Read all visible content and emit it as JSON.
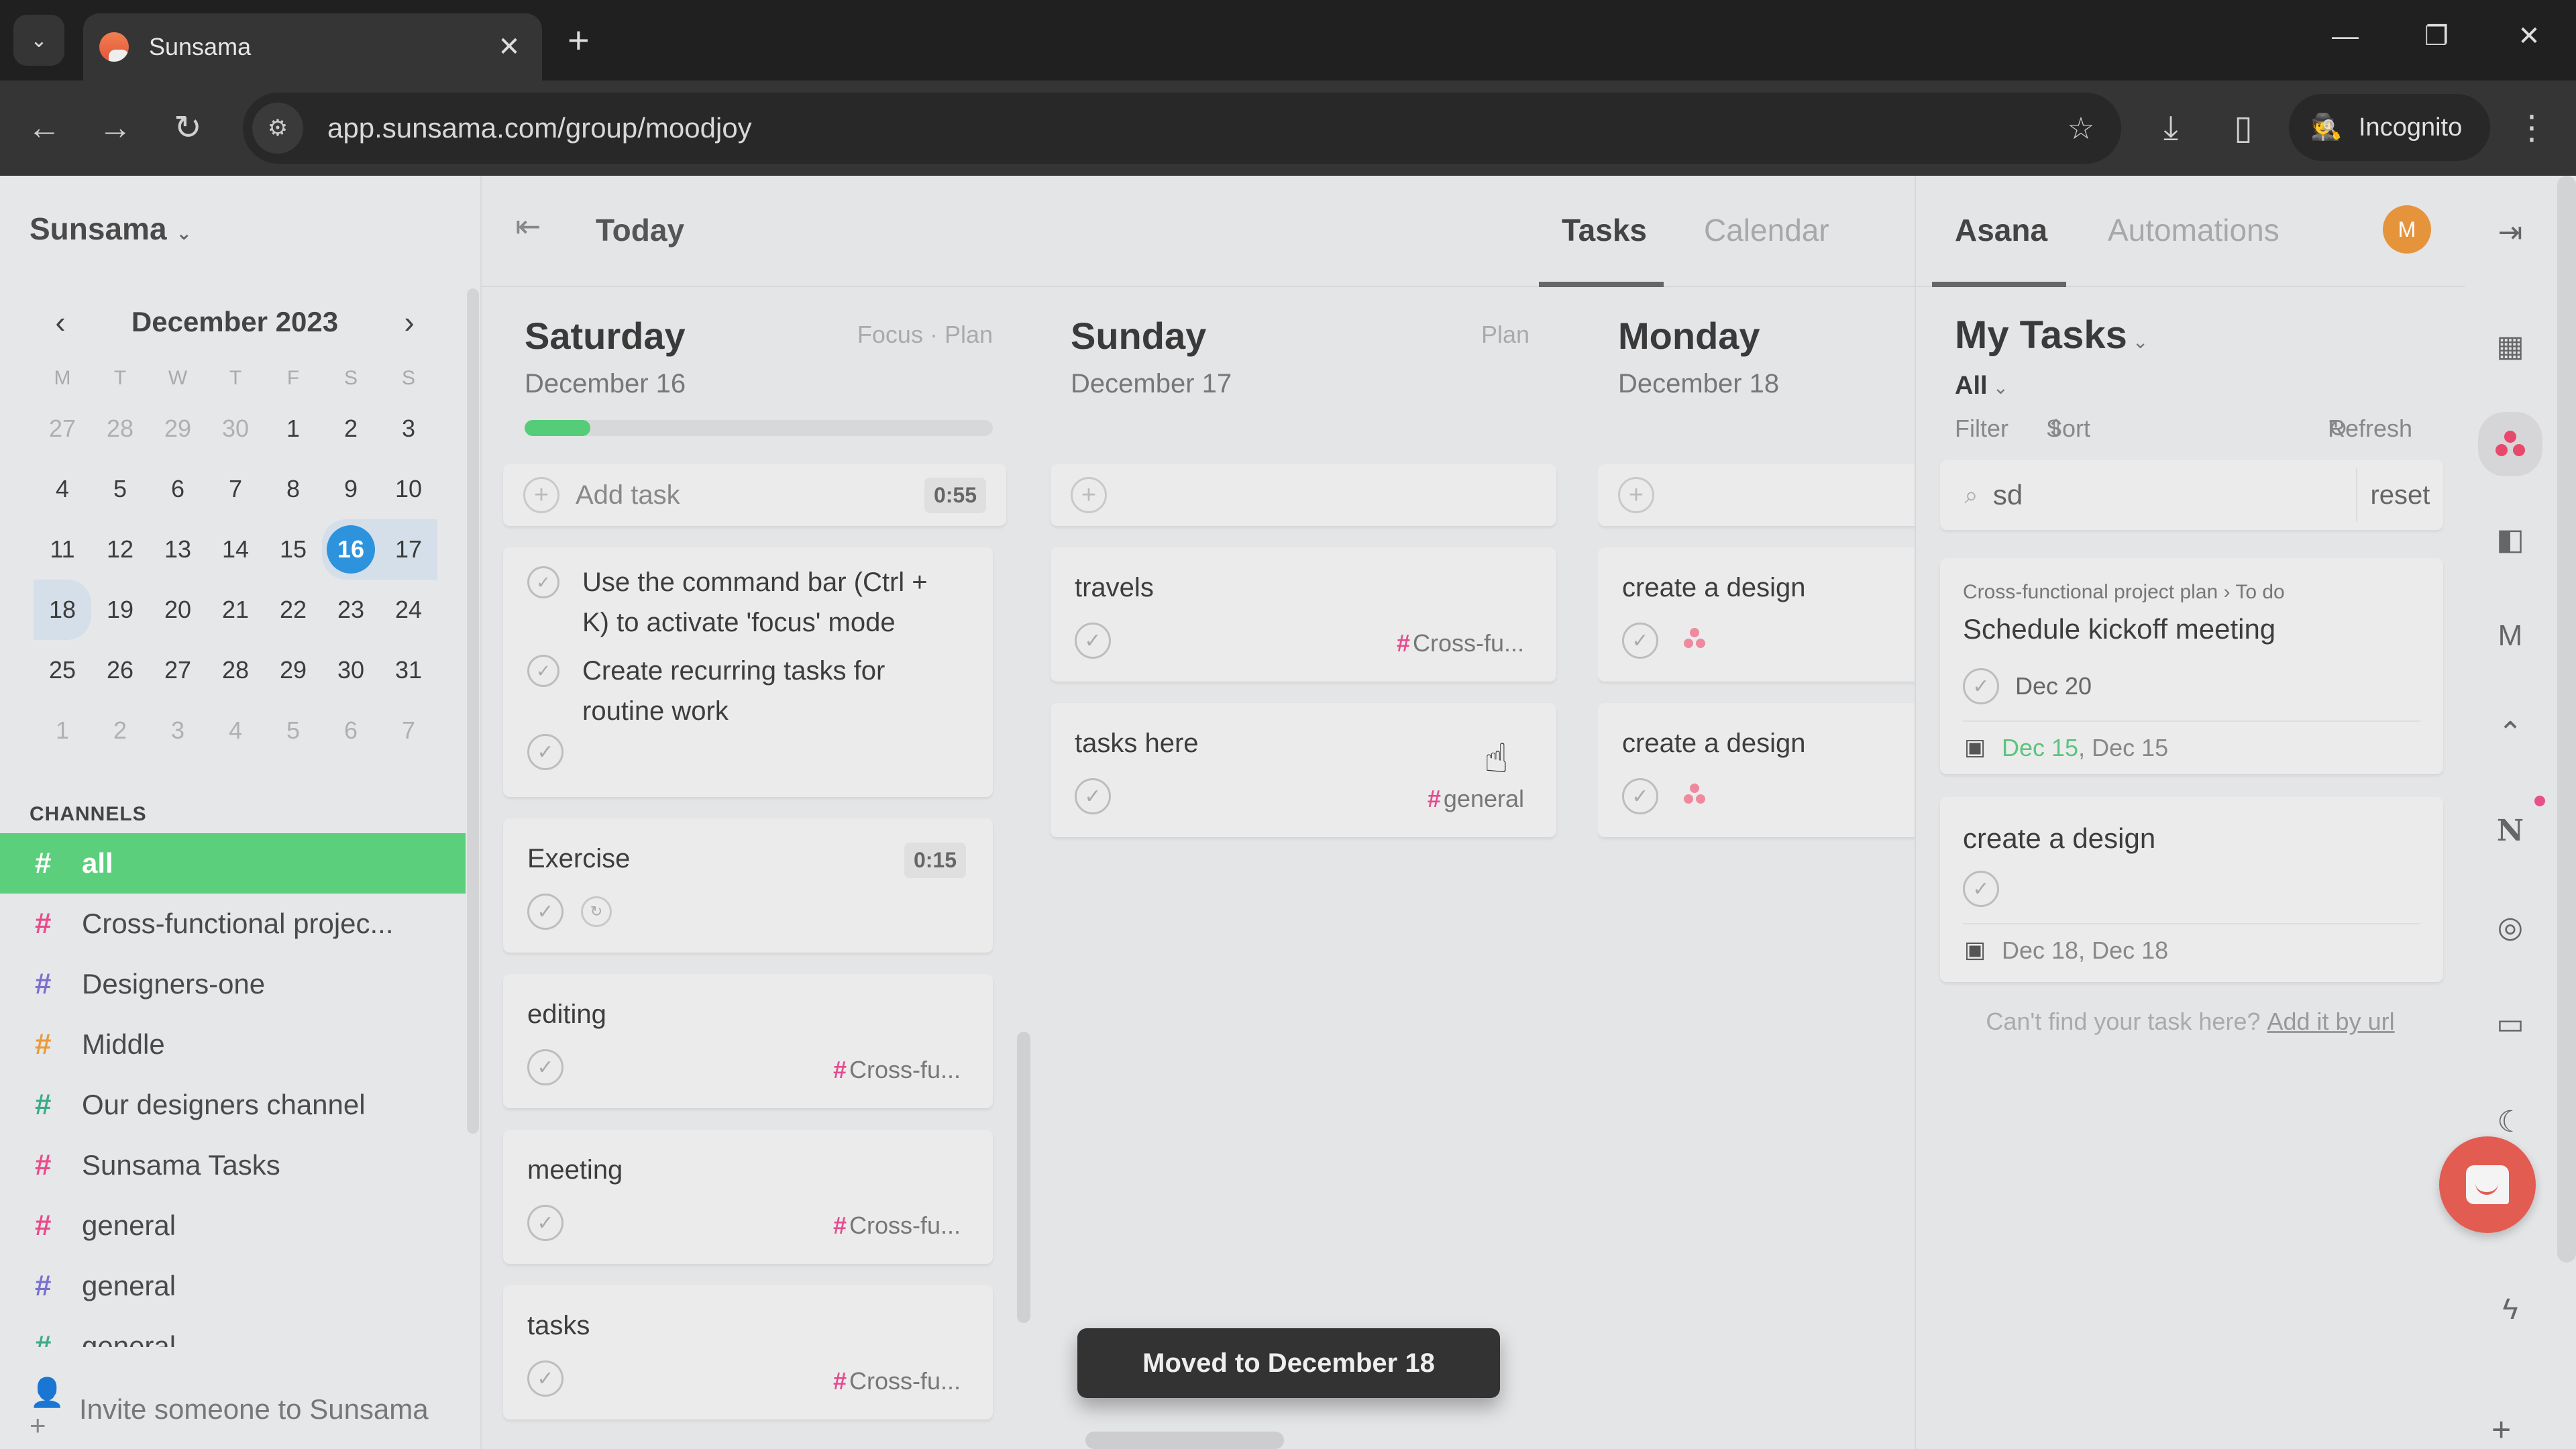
{
  "browser": {
    "tab_title": "Sunsama",
    "url": "app.sunsama.com/group/moodjoy",
    "profile_label": "Incognito",
    "icons": {
      "tab_list": "chevron-down-icon",
      "close_tab": "close-icon",
      "new_tab": "plus-icon",
      "back": "arrow-left-icon",
      "forward": "arrow-right-icon",
      "reload": "reload-icon",
      "site_info": "tune-icon",
      "bookmark": "star-icon",
      "download": "download-icon",
      "side_panel": "side-panel-icon",
      "incognito": "incognito-icon",
      "menu": "kebab-menu-icon",
      "minimize": "minimize-icon",
      "restore": "restore-icon",
      "close_window": "close-icon"
    },
    "glyphs": {
      "tab_list": "⌄",
      "close_tab": "✕",
      "new_tab": "+",
      "back": "←",
      "forward": "→",
      "reload": "↻",
      "site_info": "⚙",
      "bookmark": "☆",
      "download": "⤓",
      "side_panel": "▯",
      "incognito": "🕵",
      "menu": "⋮",
      "minimize": "—",
      "restore": "❐",
      "close_window": "✕"
    }
  },
  "sidebar": {
    "workspace": "Sunsama",
    "workspace_chevron": "⌄",
    "calendar": {
      "title": "December 2023",
      "prev": "‹",
      "next": "›",
      "weekdays": [
        "M",
        "T",
        "W",
        "T",
        "F",
        "S",
        "S"
      ],
      "weeks": [
        [
          "27",
          "28",
          "29",
          "30",
          "1",
          "2",
          "3"
        ],
        [
          "4",
          "5",
          "6",
          "7",
          "8",
          "9",
          "10"
        ],
        [
          "11",
          "12",
          "13",
          "14",
          "15",
          "16",
          "17"
        ],
        [
          "18",
          "19",
          "20",
          "21",
          "22",
          "23",
          "24"
        ],
        [
          "25",
          "26",
          "27",
          "28",
          "29",
          "30",
          "31"
        ],
        [
          "1",
          "2",
          "3",
          "4",
          "5",
          "6",
          "7"
        ]
      ],
      "today": "16",
      "visible_range": [
        "16",
        "17",
        "18"
      ]
    },
    "channels_label": "CHANNELS",
    "channels": [
      {
        "name": "all",
        "color": "#ffffff",
        "active": true
      },
      {
        "name": "Cross-functional projec...",
        "color": "#e84c8c"
      },
      {
        "name": "Designers-one",
        "color": "#7b6fd0"
      },
      {
        "name": "Middle",
        "color": "#eb9a3a"
      },
      {
        "name": "Our designers channel",
        "color": "#3daa88"
      },
      {
        "name": "Sunsama Tasks",
        "color": "#e84c8c"
      },
      {
        "name": "general",
        "color": "#e84c8c"
      },
      {
        "name": "general",
        "color": "#7b6fd0"
      },
      {
        "name": "general",
        "color": "#3daa88"
      }
    ],
    "invite_label": "Invite someone to Sunsama",
    "invite_icon": "👤+"
  },
  "header": {
    "collapse_icon": "⇤",
    "today_label": "Today",
    "tabs": [
      {
        "label": "Tasks",
        "active": true
      },
      {
        "label": "Calendar",
        "active": false
      }
    ]
  },
  "columns": [
    {
      "day": "Saturday",
      "date": "December 16",
      "actions": "Focus · Plan",
      "progress_percent": 14,
      "add_task_label": "Add task",
      "add_task_duration": "0:55",
      "checklist": [
        "Use the command bar (Ctrl + K) to activate 'focus' mode",
        "Create recurring tasks for routine work"
      ],
      "tasks": [
        {
          "title": "Exercise",
          "duration": "0:15",
          "recurring": true
        },
        {
          "title": "editing",
          "channel": "Cross-fu..."
        },
        {
          "title": "meeting",
          "channel": "Cross-fu..."
        },
        {
          "title": "tasks",
          "channel": "Cross-fu..."
        }
      ]
    },
    {
      "day": "Sunday",
      "date": "December 17",
      "actions": "Plan",
      "tasks": [
        {
          "title": "travels",
          "channel": "Cross-fu..."
        },
        {
          "title": "tasks here",
          "channel": "general"
        }
      ]
    },
    {
      "day": "Monday",
      "date": "December 18",
      "tasks": [
        {
          "title": "create a design",
          "source": "asana"
        },
        {
          "title": "create a design",
          "source": "asana"
        }
      ]
    }
  ],
  "toast": "Moved to December 18",
  "right_panel": {
    "tabs": [
      {
        "label": "Asana",
        "active": true
      },
      {
        "label": "Automations",
        "active": false
      }
    ],
    "avatar_initial": "M",
    "collapse_icon": "⇥",
    "list_title": "My Tasks",
    "filter_select": "All",
    "filter_label": "Filter",
    "sort_label": "Sort",
    "refresh_label": "Refresh",
    "search_value": "sd",
    "search_icon": "⌕",
    "reset_label": "reset",
    "cards": [
      {
        "breadcrumb_project": "Cross-functional project plan",
        "breadcrumb_section": "To do",
        "title": "Schedule kickoff meeting",
        "due": "Dec 20",
        "date_start": "Dec 15",
        "date_end": "Dec 15"
      },
      {
        "title": "create a design",
        "dates": "Dec 18, Dec 18"
      }
    ],
    "cant_find": "Can't find your task here?",
    "add_by_url": "Add it by url"
  },
  "rail": {
    "items": [
      {
        "name": "google-calendar-icon",
        "glyph": "📅"
      },
      {
        "name": "asana-icon",
        "glyph": "",
        "active": true
      },
      {
        "name": "trello-icon",
        "glyph": "◧"
      },
      {
        "name": "gmail-icon",
        "glyph": "M"
      },
      {
        "name": "clickup-icon",
        "glyph": "⌃"
      },
      {
        "name": "notion-icon",
        "glyph": "N"
      },
      {
        "name": "target-icon",
        "glyph": "◎"
      },
      {
        "name": "archive-icon",
        "glyph": "▭"
      },
      {
        "name": "night-mode-icon",
        "glyph": "☾"
      },
      {
        "name": "search-icon",
        "glyph": "⌕"
      },
      {
        "name": "bolt-icon",
        "glyph": "⚡"
      }
    ],
    "plus": "+",
    "notification_count_visible": true
  }
}
